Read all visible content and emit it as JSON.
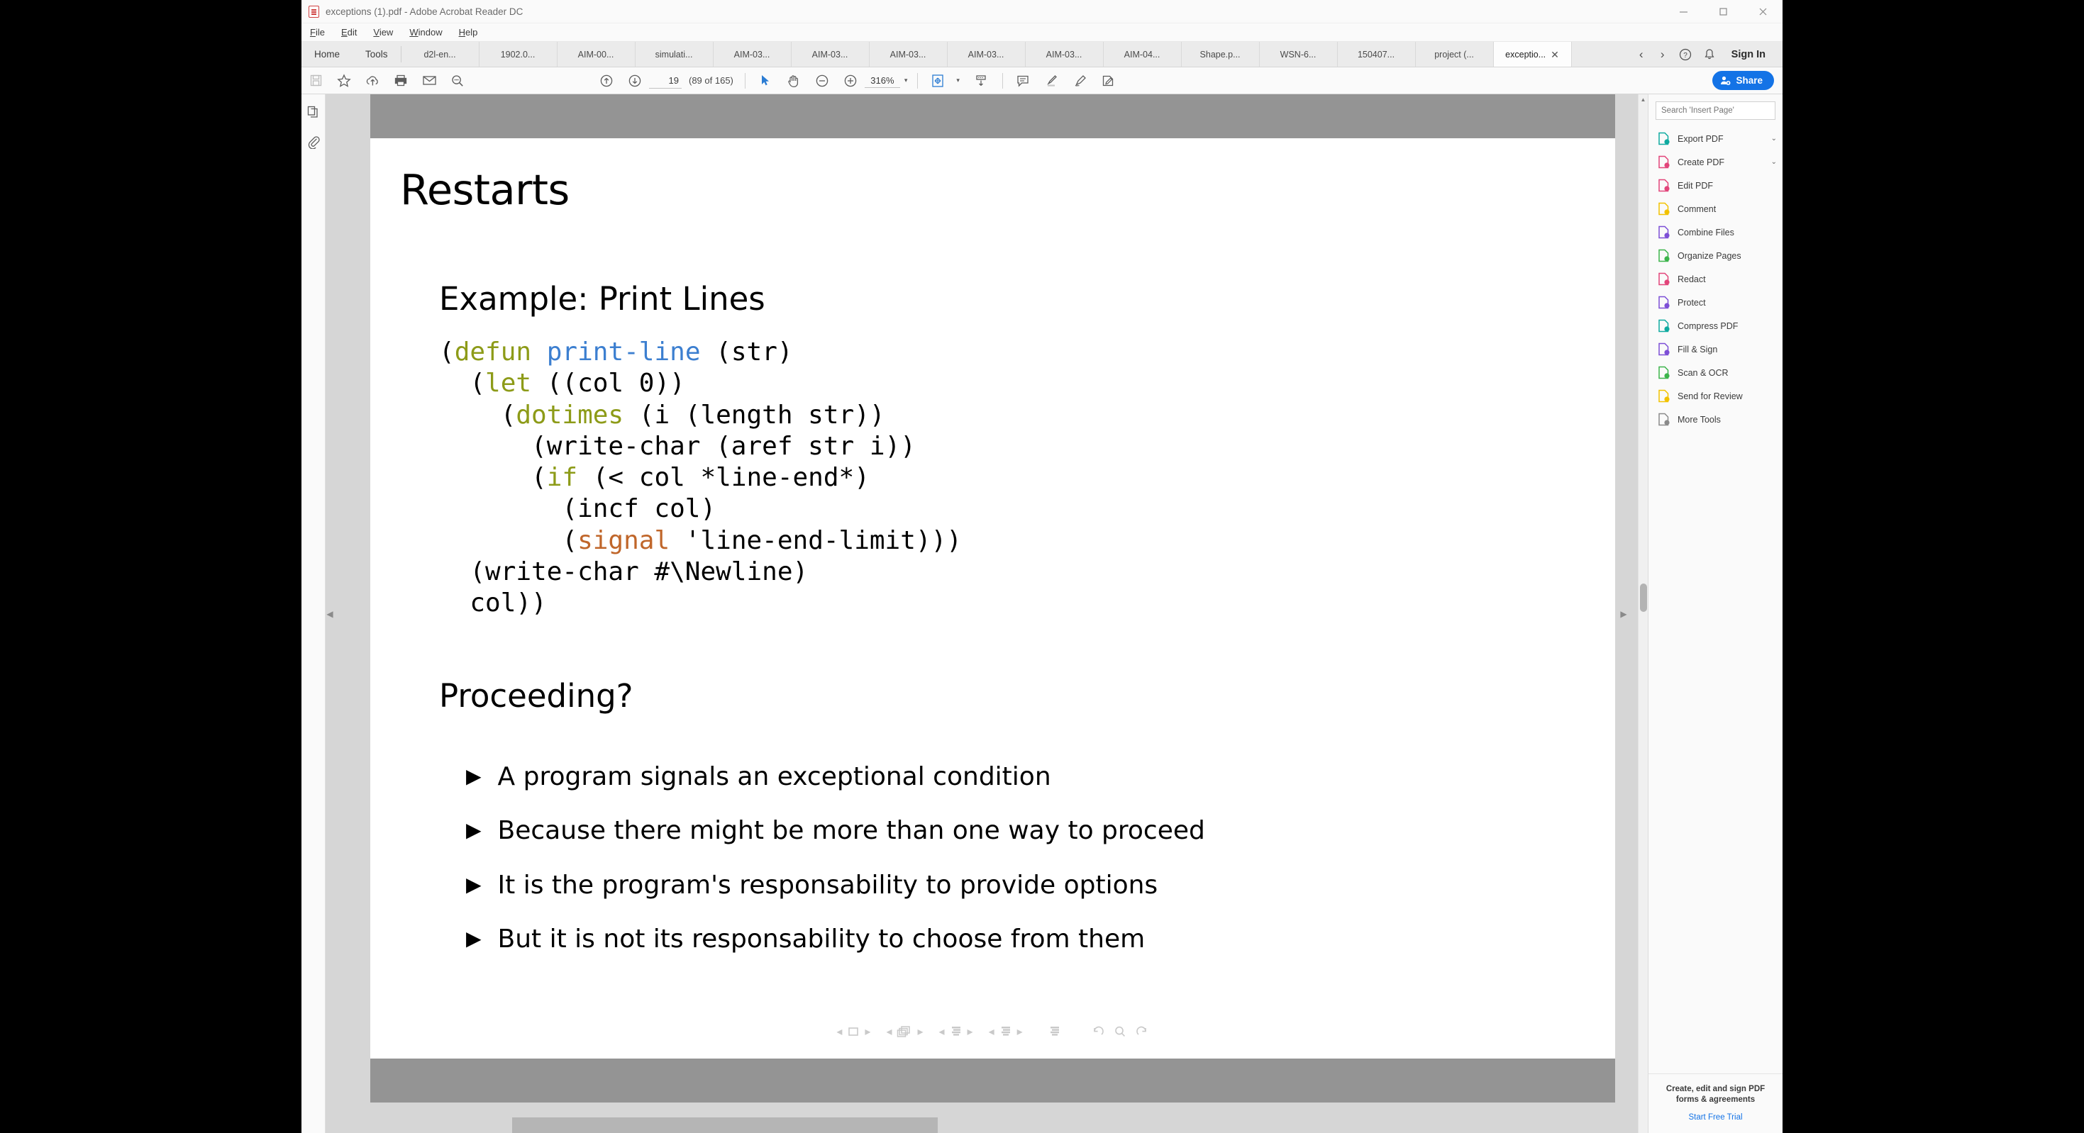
{
  "window": {
    "title": "exceptions (1).pdf - Adobe Acrobat Reader DC",
    "minimize_label": "–",
    "maximize_label": "□",
    "close_label": "✕"
  },
  "menubar": {
    "items": [
      {
        "label": "File",
        "hot": "F",
        "rest": "ile"
      },
      {
        "label": "Edit",
        "hot": "E",
        "rest": "dit"
      },
      {
        "label": "View",
        "hot": "V",
        "rest": "iew"
      },
      {
        "label": "Window",
        "hot": "W",
        "rest": "indow"
      },
      {
        "label": "Help",
        "hot": "H",
        "rest": "elp"
      }
    ]
  },
  "tabbar": {
    "home": "Home",
    "tools": "Tools",
    "documents": [
      {
        "label": "d2l-en...",
        "active": false
      },
      {
        "label": "1902.0...",
        "active": false
      },
      {
        "label": "AIM-00...",
        "active": false
      },
      {
        "label": "simulati...",
        "active": false
      },
      {
        "label": "AIM-03...",
        "active": false
      },
      {
        "label": "AIM-03...",
        "active": false
      },
      {
        "label": "AIM-03...",
        "active": false
      },
      {
        "label": "AIM-03...",
        "active": false
      },
      {
        "label": "AIM-03...",
        "active": false
      },
      {
        "label": "AIM-04...",
        "active": false
      },
      {
        "label": "Shape.p...",
        "active": false
      },
      {
        "label": "WSN-6...",
        "active": false
      },
      {
        "label": "150407...",
        "active": false
      },
      {
        "label": "project (...",
        "active": false
      },
      {
        "label": "exceptio...",
        "active": true,
        "close": "✕"
      }
    ],
    "prev_label": "‹",
    "next_label": "›",
    "help_icon": "help-icon",
    "bell_icon": "bell-icon",
    "signin_label": "Sign In"
  },
  "toolbar": {
    "save_icon": "save-icon",
    "star_icon": "star-icon",
    "upload_icon": "upload-cloud-icon",
    "print_icon": "print-icon",
    "email_icon": "email-icon",
    "search_icon": "search-icon",
    "prev_page_icon": "arrow-up-circle-icon",
    "next_page_icon": "arrow-down-circle-icon",
    "page_number": "19",
    "page_count": "(89 of 165)",
    "select_tool_icon": "cursor-icon",
    "hand_tool_icon": "hand-icon",
    "zoom_out_icon": "zoom-out-icon",
    "zoom_in_icon": "zoom-in-icon",
    "zoom_level": "316%",
    "zoom_caret": "▾",
    "fit_page_icon": "fit-page-icon",
    "fit_caret": "▾",
    "fit_width_icon": "fit-width-icon",
    "comment_icon": "comment-icon",
    "highlight_icon": "highlight-icon",
    "draw_icon": "draw-icon",
    "fill_sign_icon": "fill-sign-icon",
    "share_label": "Share"
  },
  "left_rail": {
    "thumbnails_icon": "page-thumbnails-icon",
    "attachments_icon": "attachment-icon"
  },
  "slide": {
    "title": "Restarts",
    "subtitle": "Example: Print Lines",
    "code_lines": [
      [
        {
          "t": "(",
          "c": "plain"
        },
        {
          "t": "defun",
          "c": "kw"
        },
        {
          "t": " ",
          "c": "plain"
        },
        {
          "t": "print-line",
          "c": "fn"
        },
        {
          "t": " (str)",
          "c": "plain"
        }
      ],
      [
        {
          "t": "  (",
          "c": "plain"
        },
        {
          "t": "let",
          "c": "kw"
        },
        {
          "t": " ((col 0))",
          "c": "plain"
        }
      ],
      [
        {
          "t": "    (",
          "c": "plain"
        },
        {
          "t": "dotimes",
          "c": "kw"
        },
        {
          "t": " (i (length str))",
          "c": "plain"
        }
      ],
      [
        {
          "t": "      (write-char (aref str i))",
          "c": "plain"
        }
      ],
      [
        {
          "t": "      (",
          "c": "plain"
        },
        {
          "t": "if",
          "c": "kw"
        },
        {
          "t": " (< col *line-end*)",
          "c": "plain"
        }
      ],
      [
        {
          "t": "        (incf col)",
          "c": "plain"
        }
      ],
      [
        {
          "t": "        (",
          "c": "plain"
        },
        {
          "t": "signal",
          "c": "sig"
        },
        {
          "t": " 'line-end-limit)))",
          "c": "plain"
        }
      ],
      [
        {
          "t": "  (write-char #\\Newline)",
          "c": "plain"
        }
      ],
      [
        {
          "t": "  col))",
          "c": "plain"
        }
      ]
    ],
    "section_question": "Proceeding?",
    "bullet_mark": "▶",
    "bullets": [
      "A program signals an exceptional condition",
      "Because there might be more than one way to proceed",
      "It is the program's responsability to provide options",
      "But it is not its responsability to choose from them"
    ]
  },
  "beamer_nav": {
    "prev_slide": "◂",
    "next_slide": "▸",
    "slide_icon": "slide-icon",
    "frame_icon": "frame-stack-icon",
    "subsection_icon": "subsection-icon",
    "section_icon": "section-icon",
    "toc_icon": "toc-icon",
    "back_icon": "back-arrow-icon",
    "find_icon": "find-icon",
    "forward_icon": "forward-arrow-icon"
  },
  "right_panel": {
    "search_placeholder": "Search 'Insert Page'",
    "tools": [
      {
        "label": "Export PDF",
        "icon": "export-pdf-icon",
        "color": "#0faaa0",
        "caret": "⌄"
      },
      {
        "label": "Create PDF",
        "icon": "create-pdf-icon",
        "color": "#e2457a",
        "caret": "⌄"
      },
      {
        "label": "Edit PDF",
        "icon": "edit-pdf-icon",
        "color": "#e2457a",
        "caret": ""
      },
      {
        "label": "Comment",
        "icon": "comment-tool-icon",
        "color": "#f2c200",
        "caret": ""
      },
      {
        "label": "Combine Files",
        "icon": "combine-files-icon",
        "color": "#7d4fd6",
        "caret": ""
      },
      {
        "label": "Organize Pages",
        "icon": "organize-pages-icon",
        "color": "#3cb44b",
        "caret": ""
      },
      {
        "label": "Redact",
        "icon": "redact-icon",
        "color": "#e2457a",
        "caret": ""
      },
      {
        "label": "Protect",
        "icon": "protect-icon",
        "color": "#7d4fd6",
        "caret": ""
      },
      {
        "label": "Compress PDF",
        "icon": "compress-pdf-icon",
        "color": "#0faaa0",
        "caret": ""
      },
      {
        "label": "Fill & Sign",
        "icon": "fill-sign-tool-icon",
        "color": "#7d4fd6",
        "caret": ""
      },
      {
        "label": "Scan & OCR",
        "icon": "scan-ocr-icon",
        "color": "#3cb44b",
        "caret": ""
      },
      {
        "label": "Send for Review",
        "icon": "send-review-icon",
        "color": "#f2c200",
        "caret": ""
      },
      {
        "label": "More Tools",
        "icon": "more-tools-icon",
        "color": "#8a8a8a",
        "caret": ""
      }
    ],
    "promo_line1": "Create, edit and sign PDF",
    "promo_line2": "forms & agreements",
    "promo_link": "Start Free Trial"
  },
  "colors": {
    "accent_blue": "#1473e6",
    "page_gray": "#949494",
    "viewport_gray": "#d6d6d6",
    "code_keyword": "#8d9b18",
    "code_function": "#3c7fd0",
    "code_signal": "#c0662a"
  }
}
